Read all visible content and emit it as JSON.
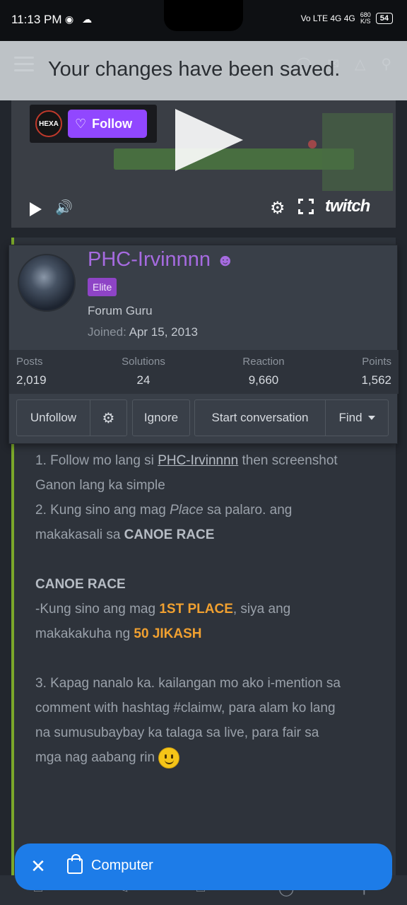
{
  "status_bar": {
    "time": "11:13 PM",
    "left_icons": "◉ ☁",
    "network": "Vo LTE  4G  4G",
    "speed_value": "680",
    "speed_unit": "K/S",
    "battery": "54"
  },
  "toast": {
    "message": "Your changes have been saved."
  },
  "video": {
    "follow_label": "Follow",
    "channel_avatar_text": "HEXA",
    "brand": "twitch"
  },
  "member_card": {
    "username": "PHC-Irvinnnn",
    "badge": "Elite",
    "user_title": "Forum Guru",
    "joined_label": "Joined:",
    "joined_date": "Apr 15, 2013",
    "stats": [
      {
        "label": "Posts",
        "value": "2,019"
      },
      {
        "label": "Solutions",
        "value": "24"
      },
      {
        "label": "Reaction",
        "value": "9,660"
      },
      {
        "label": "Points",
        "value": "1,562"
      }
    ],
    "actions": {
      "unfollow": "Unfollow",
      "ignore": "Ignore",
      "start_conversation": "Start conversation",
      "find": "Find"
    }
  },
  "post": {
    "l1_a": "1. Follow mo lang si ",
    "l1_link": "PHC-Irvinnnn",
    "l1_b": " then screenshot",
    "l2": "Ganon lang ka simple",
    "l3_a": "2. Kung sino ang mag ",
    "l3_it": "Place",
    "l3_b": " sa palaro. ang",
    "l4_a": "makakasali sa ",
    "l4_b": "CANOE RACE",
    "heading": "CANOE RACE",
    "l6_a": "-Kung sino ang mag ",
    "l6_b": "1ST PLACE",
    "l6_c": ", siya ang",
    "l7_a": "makakakuha ng ",
    "l7_b": "50 JIKASH",
    "l8": "3. Kapag nanalo ka. kailangan mo ako i-mention sa",
    "l9": "comment with hashtag #claimw, para alam ko lang",
    "l10": "na sumusubaybay ka talaga sa live, para fair sa",
    "l11": "mga nag aabang rin "
  },
  "pill": {
    "close": "✕",
    "label": "Computer"
  },
  "colors": {
    "username": "#a66be0",
    "badge": "#8e44c6",
    "highlight": "#f0a030",
    "accent_bar": "#7ba82a",
    "pill": "#1d7ce8",
    "twitch_follow": "#9147ff"
  }
}
